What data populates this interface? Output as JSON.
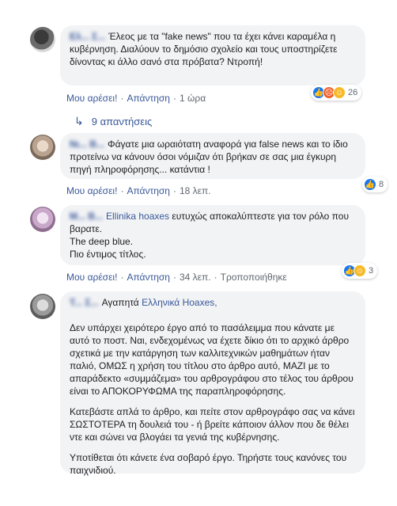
{
  "comments": [
    {
      "author": "Eλ... Σ...",
      "text": "Έλεος με τα \"fake news\" που τα έχει κάνει καραμέλα η κυβέρνηση. Διαλύουν το δημόσιο σχολείο και τους υποστηρίζετε δίνοντας κι άλλο σανό στα πρόβατα? Ντροπή!",
      "like": "Μου αρέσει!",
      "reply": "Απάντηση",
      "time": "1 ώρα",
      "reaction_count": "26",
      "reaction_icons": [
        "like-icon",
        "angry-icon",
        "wow-icon"
      ]
    },
    {
      "author": "Νι... Β...",
      "text": "Φάγατε μια ωραιότατη αναφορά για false news και το ίδιο προτείνω να κάνουν όσοι νόμιζαν ότι βρήκαν σε σας μια έγκυρη πηγή πληροφόρησης... κατάντια !",
      "like": "Μου αρέσει!",
      "reply": "Απάντηση",
      "time": "18 λεπ.",
      "reaction_count": "8",
      "reaction_icons": [
        "like-icon"
      ]
    },
    {
      "author": "Μ... Β...",
      "text_mention": "Ellinika hoaxes",
      "text_lines": [
        "ευτυχώς αποκαλύπτεστε για τον ρόλο που βαρατε.",
        "The deep blue.",
        "Πιο έντιμος τίτλος."
      ],
      "like": "Μου αρέσει!",
      "reply": "Απάντηση",
      "time": "34 λεπ.",
      "edited": "Τροποποιήθηκε",
      "reaction_count": "3",
      "reaction_icons": [
        "like-icon",
        "haha-icon"
      ]
    },
    {
      "author": "Τ... Σ...",
      "greeting": "Αγαπητά",
      "mention": "Ελληνικά Hoaxes,",
      "paragraphs": [
        "Δεν υπάρχει χειρότερο έργο από το πασάλειμμα που κάνατε με αυτό το ποστ. Ναι, ενδεχομένως να έχετε δίκιο ότι το αρχικό άρθρο σχετικά με την κατάργηση των καλλιτεχνικών μαθημάτων ήταν παλιό, ΟΜΩΣ η χρήση του τίτλου στο άρθρο αυτό, ΜΑΖΙ με το απαράδεκτο «συμμάζεμα» του αρθρογράφου στο τέλος του άρθρου είναι το ΑΠΟΚΟΡΥΦΩΜΑ της παραπληροφόρησης.",
        "Κατεβάστε απλά το άρθρο, και πείτε στον αρθρογράφο σας να κάνει ΣΩΣΤΟΤΕΡΑ τη δουλειά του - ή βρείτε κάποιον άλλον που δε θέλει ντε και σώνει να βλογάει τα γενιά της κυβέρνησης.",
        "Υποτίθεται ότι κάνετε ένα σοβαρό έργο. Τηρήστε τους κανόνες του παιχνιδιού."
      ]
    }
  ],
  "replies_label": "9 απαντήσεις"
}
